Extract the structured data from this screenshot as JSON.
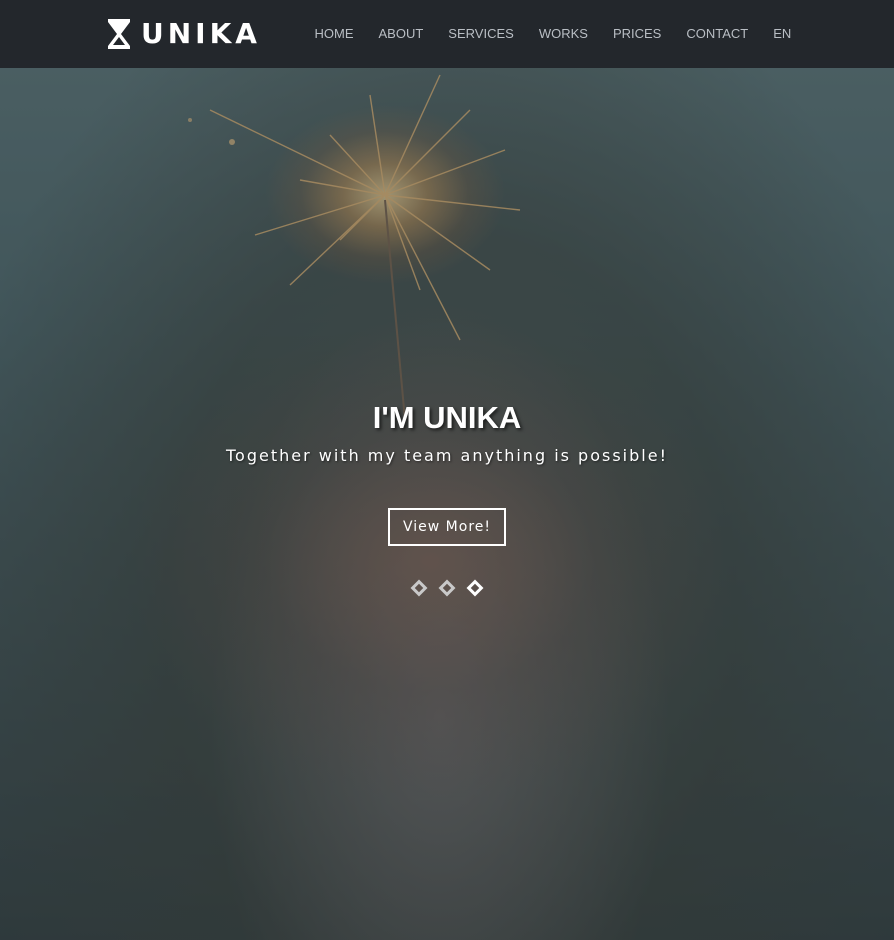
{
  "brand": {
    "name": "UNIKA",
    "logo_icon": "hourglass-x-icon"
  },
  "nav": {
    "items": [
      {
        "label": "HOME"
      },
      {
        "label": "ABOUT"
      },
      {
        "label": "SERVICES"
      },
      {
        "label": "WORKS"
      },
      {
        "label": "PRICES"
      },
      {
        "label": "CONTACT"
      },
      {
        "label": "EN"
      }
    ]
  },
  "hero": {
    "title": "I'M UNIKA",
    "subtitle": "Together with my team anything is possible!",
    "button_label": "View More!",
    "slider": {
      "slide_count": 3,
      "active_index": 2
    }
  },
  "colors": {
    "navbar_bg": "#23272c",
    "nav_text": "#b9bec4",
    "accent": "#ffffff"
  }
}
